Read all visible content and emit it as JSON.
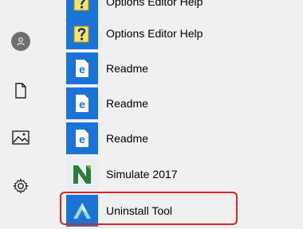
{
  "rail": {
    "items": [
      {
        "name": "user-account-icon"
      },
      {
        "name": "documents-icon"
      },
      {
        "name": "pictures-icon"
      },
      {
        "name": "settings-icon"
      }
    ]
  },
  "apps": [
    {
      "label": "Options Editor Help",
      "icon": "help-file-icon"
    },
    {
      "label": "Options Editor Help",
      "icon": "help-file-icon"
    },
    {
      "label": "Readme",
      "icon": "edge-document-icon"
    },
    {
      "label": "Readme",
      "icon": "edge-document-icon"
    },
    {
      "label": "Readme",
      "icon": "edge-document-icon"
    },
    {
      "label": "Simulate 2017",
      "icon": "simulate-app-icon"
    },
    {
      "label": "Uninstall Tool",
      "icon": "autodesk-uninstall-icon"
    }
  ],
  "colors": {
    "tile_blue": "#1a73d6",
    "highlight_red": "#e02424",
    "simulate_green": "#2d7a3a"
  }
}
